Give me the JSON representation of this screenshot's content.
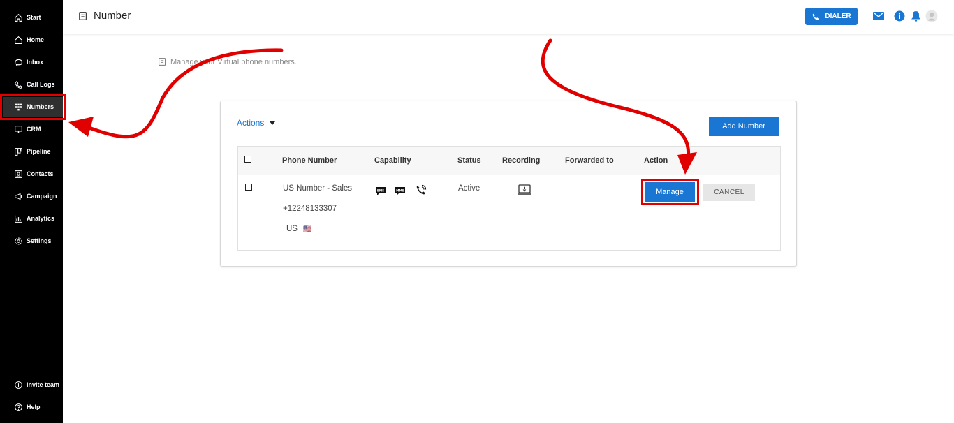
{
  "sidebar": {
    "items": [
      {
        "label": "Start",
        "icon": "home-outline-icon"
      },
      {
        "label": "Home",
        "icon": "home-icon"
      },
      {
        "label": "Inbox",
        "icon": "inbox-icon"
      },
      {
        "label": "Call Logs",
        "icon": "phone-icon"
      },
      {
        "label": "Numbers",
        "icon": "dialpad-icon",
        "active": true
      },
      {
        "label": "CRM",
        "icon": "monitor-icon"
      },
      {
        "label": "Pipeline",
        "icon": "pipeline-icon"
      },
      {
        "label": "Contacts",
        "icon": "contacts-icon"
      },
      {
        "label": "Campaign",
        "icon": "megaphone-icon"
      },
      {
        "label": "Analytics",
        "icon": "bar-chart-icon"
      },
      {
        "label": "Settings",
        "icon": "gear-icon"
      }
    ],
    "bottom": [
      {
        "label": "Invite team",
        "icon": "plus-circle-icon"
      },
      {
        "label": "Help",
        "icon": "help-circle-icon"
      }
    ]
  },
  "header": {
    "title": "Number",
    "dialer_label": "DIALER"
  },
  "subtitle": "Manage your Virtual phone numbers.",
  "card": {
    "actions_label": "Actions",
    "add_number_label": "Add Number",
    "columns": [
      "Phone Number",
      "Capability",
      "Status",
      "Recording",
      "Forwarded to",
      "Action"
    ],
    "row": {
      "name": "US Number - Sales",
      "number": "+12248133307",
      "country": "US",
      "flag": "🇺🇸",
      "capabilities": [
        "sms-icon",
        "mms-icon",
        "voice-call-icon"
      ],
      "status": "Active",
      "recording_icon": "recording-monitor-icon",
      "forwarded_to": "",
      "manage_label": "Manage",
      "cancel_label": "CANCEL"
    }
  },
  "colors": {
    "primary": "#1976d2",
    "sidebar_bg": "#000000",
    "highlight": "#e00000"
  }
}
